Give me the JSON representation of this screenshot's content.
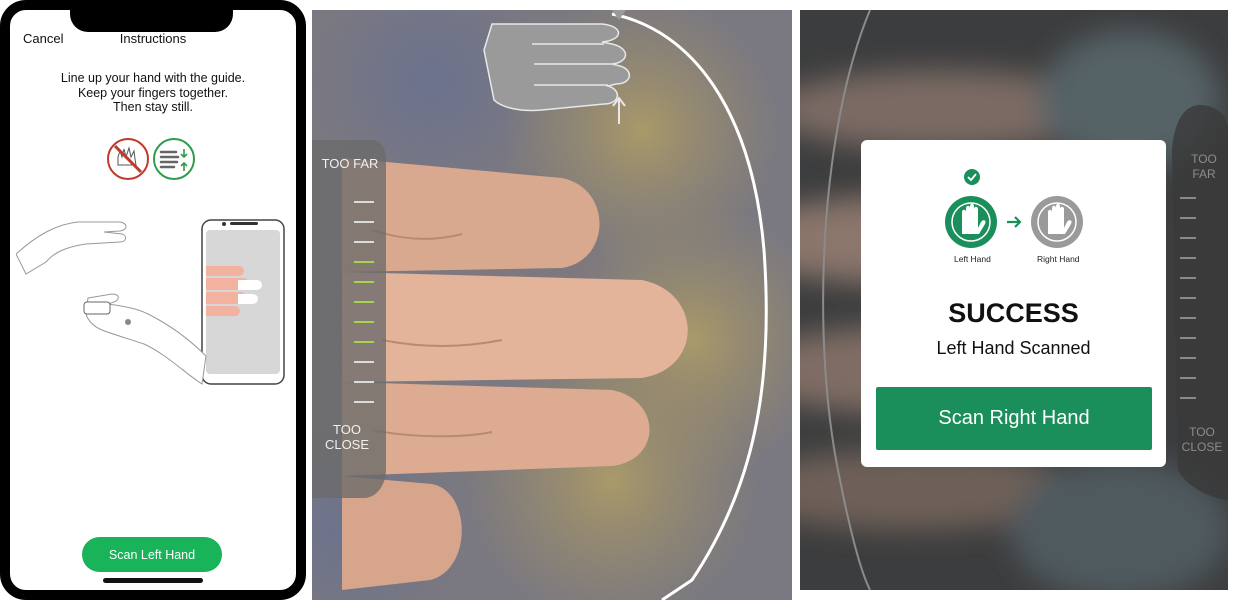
{
  "instructions_screen": {
    "header": {
      "cancel_label": "Cancel",
      "title": "Instructions"
    },
    "instructions": [
      "Line up your hand with the guide.",
      "Keep your fingers together.",
      "Then stay still."
    ],
    "tip_icons": [
      "spread-fingers-prohibited-icon",
      "fingers-together-icon"
    ],
    "scan_button_label": "Scan Left Hand",
    "accent_color": "#19b35a"
  },
  "camera_screen": {
    "distance_scale": {
      "top_label": "TOO FAR",
      "bottom_label_lines": [
        "TOO",
        "CLOSE"
      ],
      "in_range_color": "#a6d44a"
    },
    "guide_icon": "hand-guide-icon"
  },
  "success_screen": {
    "steps": [
      {
        "label": "Left Hand",
        "status": "done",
        "icon": "hand-icon",
        "color": "#1b8f5b"
      },
      {
        "label": "Right Hand",
        "status": "pending",
        "icon": "hand-icon",
        "color": "#9a9a9a"
      }
    ],
    "title": "SUCCESS",
    "subtitle": "Left Hand Scanned",
    "button_label": "Scan Right Hand",
    "background_scale": {
      "top_label_lines": [
        "TOO",
        "FAR"
      ],
      "bottom_label_lines": [
        "TOO",
        "CLOSE"
      ]
    },
    "accent_color": "#1b8f5b"
  }
}
